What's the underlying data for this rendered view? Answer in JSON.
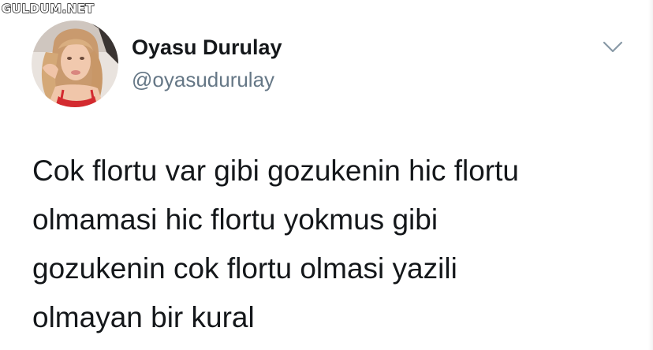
{
  "watermark": {
    "text": "GULDUM.NET"
  },
  "tweet": {
    "author": {
      "display_name": "Oyasu Durulay",
      "handle": "@oyasudurulay"
    },
    "text_lines": [
      "Cok flortu var gibi gozukenin hic flortu",
      "olmamasi hic flortu yokmus gibi",
      "gozukenin cok flortu olmasi yazili",
      "olmayan bir kural"
    ],
    "menu_icon": "chevron-down-icon"
  },
  "colors": {
    "text_primary": "#14171a",
    "text_secondary": "#657786",
    "chevron": "#8899a6",
    "background": "#ffffff"
  }
}
